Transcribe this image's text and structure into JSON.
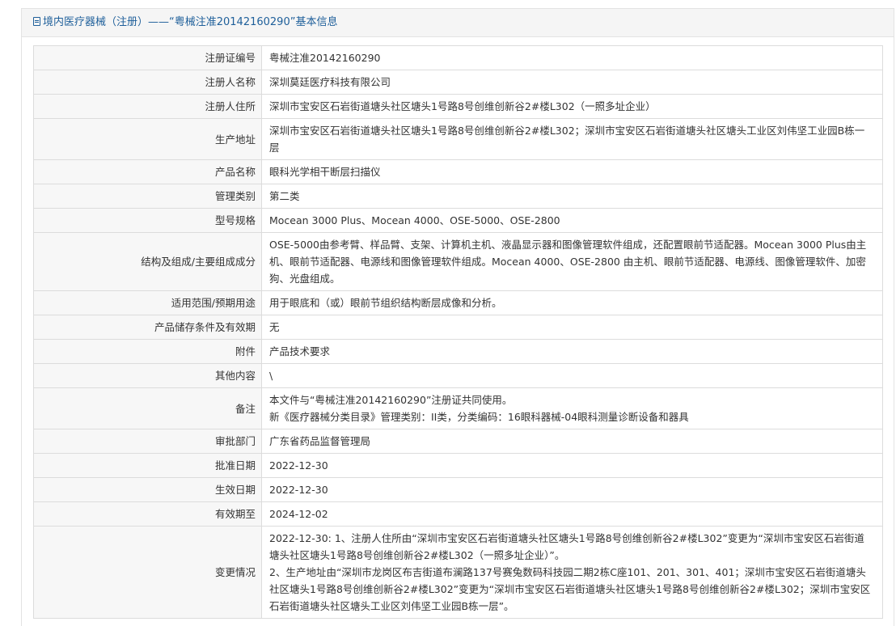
{
  "header": {
    "title": "境内医疗器械（注册）——“粤械注准20142160290”基本信息"
  },
  "rows": [
    {
      "label": "注册证编号",
      "lines": [
        "粤械注准20142160290"
      ]
    },
    {
      "label": "注册人名称",
      "lines": [
        "深圳莫廷医疗科技有限公司"
      ]
    },
    {
      "label": "注册人住所",
      "lines": [
        "深圳市宝安区石岩街道塘头社区塘头1号路8号创维创新谷2#楼L302（一照多址企业）"
      ]
    },
    {
      "label": "生产地址",
      "lines": [
        "深圳市宝安区石岩街道塘头社区塘头1号路8号创维创新谷2#楼L302；深圳市宝安区石岩街道塘头社区塘头工业区刘伟坚工业园B栋一层"
      ]
    },
    {
      "label": "产品名称",
      "lines": [
        "眼科光学相干断层扫描仪"
      ]
    },
    {
      "label": "管理类别",
      "lines": [
        "第二类"
      ]
    },
    {
      "label": "型号规格",
      "lines": [
        "Mocean 3000 Plus、Mocean 4000、OSE-5000、OSE-2800"
      ]
    },
    {
      "label": "结构及组成/主要组成成分",
      "lines": [
        "OSE-5000由参考臂、样品臂、支架、计算机主机、液晶显示器和图像管理软件组成，还配置眼前节适配器。Mocean 3000 Plus由主机、眼前节适配器、电源线和图像管理软件组成。Mocean 4000、OSE-2800 由主机、眼前节适配器、电源线、图像管理软件、加密狗、光盘组成。"
      ]
    },
    {
      "label": "适用范围/预期用途",
      "lines": [
        "用于眼底和（或）眼前节组织结构断层成像和分析。"
      ]
    },
    {
      "label": "产品储存条件及有效期",
      "lines": [
        "无"
      ]
    },
    {
      "label": "附件",
      "lines": [
        "产品技术要求"
      ]
    },
    {
      "label": "其他内容",
      "lines": [
        "\\"
      ]
    },
    {
      "label": "备注",
      "lines": [
        "本文件与“粤械注准20142160290”注册证共同使用。",
        "新《医疗器械分类目录》管理类别：II类，分类编码：16眼科器械-04眼科测量诊断设备和器具"
      ]
    },
    {
      "label": "审批部门",
      "lines": [
        "广东省药品监督管理局"
      ]
    },
    {
      "label": "批准日期",
      "lines": [
        "2022-12-30"
      ]
    },
    {
      "label": "生效日期",
      "lines": [
        "2022-12-30"
      ]
    },
    {
      "label": "有效期至",
      "lines": [
        "2024-12-02"
      ]
    },
    {
      "label": "变更情况",
      "lines": [
        "2022-12-30: 1、注册人住所由“深圳市宝安区石岩街道塘头社区塘头1号路8号创维创新谷2#楼L302”变更为“深圳市宝安区石岩街道塘头社区塘头1号路8号创维创新谷2#楼L302（一照多址企业）”。",
        "2、生产地址由“深圳市龙岗区布吉街道布澜路137号赛兔数码科技园二期2栋C座101、201、301、401；深圳市宝安区石岩街道塘头社区塘头1号路8号创维创新谷2#楼L302”变更为“深圳市宝安区石岩街道塘头社区塘头1号路8号创维创新谷2#楼L302；深圳市宝安区石岩街道塘头社区塘头工业区刘伟坚工业园B栋一层”。"
      ]
    }
  ]
}
